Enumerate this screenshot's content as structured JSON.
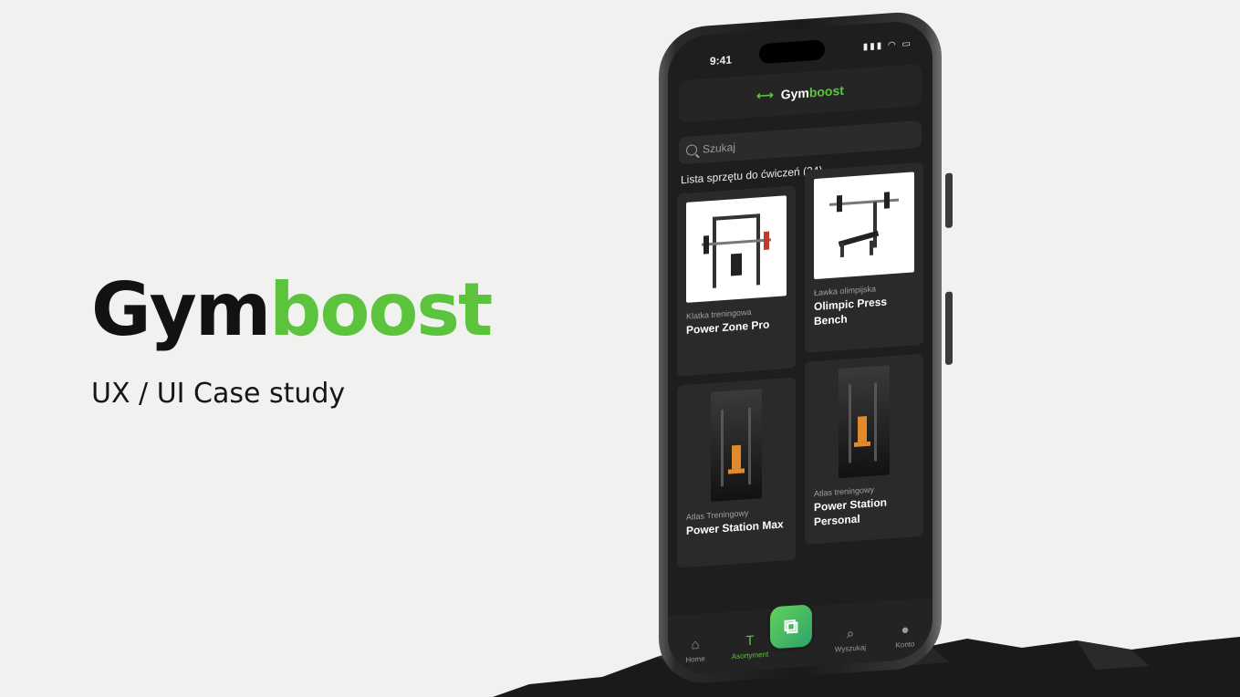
{
  "hero": {
    "title_part1": "Gym",
    "title_part2": "boost",
    "subtitle": "UX / UI Case study"
  },
  "phone": {
    "status_time": "9:41",
    "status_icons": "signal-icon wifi-icon battery-icon",
    "header": {
      "logo_icon": "dumbbell-icon",
      "title_part1": "Gym",
      "title_part2": "boost"
    },
    "search": {
      "placeholder": "Szukaj"
    },
    "list_title": "Lista sprzętu do ćwiczeń (24)",
    "cards": [
      {
        "category": "Klatka treningowa",
        "name": "Power Zone Pro",
        "image": "power-rack-image"
      },
      {
        "category": "Ławka olimpijska",
        "name": "Olimpic Press Bench",
        "image": "press-bench-image"
      },
      {
        "category": "Atlas Treningowy",
        "name": "Power Station Max",
        "image": "gym-station-image"
      },
      {
        "category": "Atlas treningowy",
        "name": "Power Station Personal",
        "image": "gym-station-image"
      }
    ],
    "tabs": [
      {
        "label": "Home",
        "icon": "home-icon"
      },
      {
        "label": "Asortyment",
        "icon": "dumbbell-icon"
      },
      {
        "label": "Wyszukaj",
        "icon": "search-icon"
      },
      {
        "label": "Konto",
        "icon": "user-icon"
      }
    ],
    "scan_button_icon": "scan-icon"
  },
  "colors": {
    "accent": "#5cc43c",
    "background": "#f1f1f0",
    "screen": "#1e1e1e"
  }
}
